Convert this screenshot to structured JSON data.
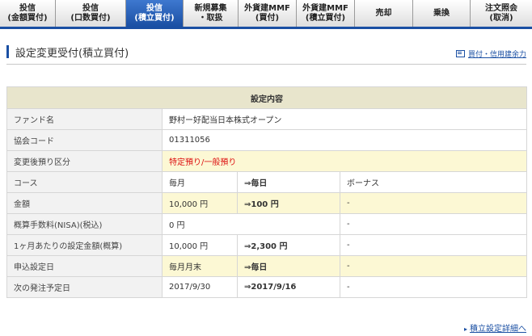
{
  "tabs": [
    {
      "line1": "投信",
      "line2": "(金額買付)",
      "active": false
    },
    {
      "line1": "投信",
      "line2": "(口数買付)",
      "active": false
    },
    {
      "line1": "投信",
      "line2": "(積立買付)",
      "active": true
    },
    {
      "line1": "新規募集",
      "line2": "・取扱",
      "active": false
    },
    {
      "line1": "外貨建MMF",
      "line2": "(買付)",
      "active": false
    },
    {
      "line1": "外貨建MMF",
      "line2": "(積立買付)",
      "active": false
    },
    {
      "line1": "売却",
      "line2": "",
      "active": false
    },
    {
      "line1": "乗換",
      "line2": "",
      "active": false
    },
    {
      "line1": "注文照会",
      "line2": "(取消)",
      "active": false
    }
  ],
  "page": {
    "title": "設定変更受付(積立買付)",
    "top_link": "買付・信用建余力",
    "bottom_link": "積立設定詳細へ"
  },
  "table": {
    "header": "設定内容",
    "fund_name_label": "ファンド名",
    "fund_name_value": "野村ー好配当日本株式オープン",
    "assoc_code_label": "協会コード",
    "assoc_code_value": "01311056",
    "custody_label": "変更後預り区分",
    "custody_value": "特定預り/一般預り",
    "course_label": "コース",
    "course_old": "毎月",
    "course_new": "⇒毎日",
    "course_bonus": "ボーナス",
    "amount_label": "金額",
    "amount_old": "10,000 円",
    "amount_new": "⇒100 円",
    "amount_bonus": "-",
    "fee_label": "概算手数料(NISA)(税込)",
    "fee_value": "0 円",
    "fee_bonus": "-",
    "monthly_label": "1ヶ月あたりの設定金額(概算)",
    "monthly_old": "10,000 円",
    "monthly_new": "⇒2,300 円",
    "monthly_bonus": "-",
    "apply_label": "申込設定日",
    "apply_old": "毎月月末",
    "apply_new": "⇒毎日",
    "apply_bonus": "-",
    "next_label": "次の発注予定日",
    "next_old": "2017/9/30",
    "next_new": "⇒2017/9/16",
    "next_bonus": "-"
  },
  "colors": {
    "accent": "#1a4fa3",
    "highlight_row": "#fcf8d4",
    "header_bg": "#e8e5cc",
    "warning_text": "#dd1111"
  }
}
